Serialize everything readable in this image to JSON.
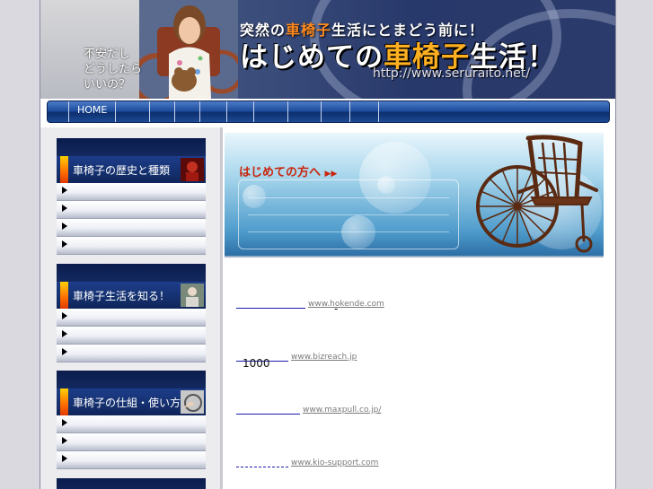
{
  "header": {
    "worry_lines": [
      "不安だし",
      "どうしたら",
      "いいの？"
    ],
    "tagline_pre": "突然の",
    "tagline_highlight": "車椅子",
    "tagline_post": "生活にとまどう前に！",
    "title_pre": "はじめての",
    "title_highlight": "車椅子",
    "title_post": "生活！",
    "url": "http://www.seruraito.net/"
  },
  "nav": {
    "home_label": "HOME"
  },
  "sidebar": {
    "sections": [
      {
        "label": "車椅子の歴史と種類",
        "icon": "red-portrait-icon",
        "items": [
          "",
          "",
          "",
          ""
        ]
      },
      {
        "label": "車椅子生活を知る！",
        "icon": "elderly-person-icon",
        "items": [
          "",
          "",
          ""
        ]
      },
      {
        "label": "車椅子の仕組・使い方",
        "icon": "hand-wheel-icon",
        "items": [
          "",
          "",
          ""
        ]
      }
    ]
  },
  "banner": {
    "title": "はじめての方へ",
    "arrows": "▶▶"
  },
  "ads": [
    {
      "url": "www.hokende.com",
      "desc": "-"
    },
    {
      "url": "www.bizreach.jp",
      "desc": "1000"
    },
    {
      "url": "www.maxpull.co.jp/",
      "desc": ""
    },
    {
      "url": "www.kio-support.com",
      "desc": ""
    }
  ],
  "colors": {
    "accent_orange": "#ff8a1f",
    "nav_blue": "#1f4e9e",
    "banner_title_red": "#c8240c"
  }
}
